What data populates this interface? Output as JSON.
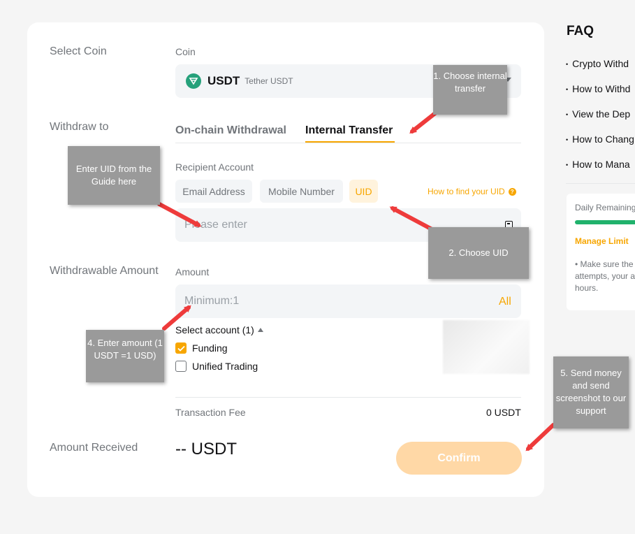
{
  "sections": {
    "select_coin": "Select Coin",
    "withdraw_to": "Withdraw to",
    "withdrawable_amount": "Withdrawable Amount",
    "amount_received": "Amount Received"
  },
  "coin": {
    "label": "Coin",
    "symbol": "USDT",
    "name": "Tether USDT"
  },
  "tabs": [
    {
      "label": "On-chain Withdrawal"
    },
    {
      "label": "Internal Transfer"
    }
  ],
  "recipient": {
    "label": "Recipient Account",
    "chips": [
      "Email Address",
      "Mobile Number",
      "UID"
    ],
    "how_to_find": "How to find your UID",
    "placeholder": "Please enter"
  },
  "amount": {
    "label": "Amount",
    "placeholder": "Minimum:1",
    "all_label": "All"
  },
  "accounts": {
    "select_label": "Select account (1)",
    "items": [
      {
        "label": "Funding",
        "checked": true
      },
      {
        "label": "Unified Trading",
        "checked": false
      }
    ]
  },
  "fee": {
    "label": "Transaction Fee",
    "value": "0 USDT"
  },
  "received": {
    "value": "-- USDT"
  },
  "confirm_label": "Confirm",
  "faq": {
    "title": "FAQ",
    "items": [
      "Crypto Withd",
      "How to Withd",
      "View the Dep",
      "How to Chang",
      "How to Mana"
    ]
  },
  "limit": {
    "label": "Daily Remaining",
    "manage": "Manage Limit",
    "note": "• Make sure the attempts, your a hours."
  },
  "tooltips": {
    "tip1": "1. Choose internal transfer",
    "tip2": "Enter UID from the Guide here",
    "tip3": "2. Choose UID",
    "tip4": "4. Enter amount (1 USDT =1 USD)",
    "tip5": "5. Send money and send screenshot to our support"
  },
  "colors": {
    "accent": "#f7a600",
    "tether": "#26a17b",
    "limit_bar": "#20b26c",
    "tooltip_bg": "#9a9a9a",
    "arrow": "#ee3b3b"
  }
}
